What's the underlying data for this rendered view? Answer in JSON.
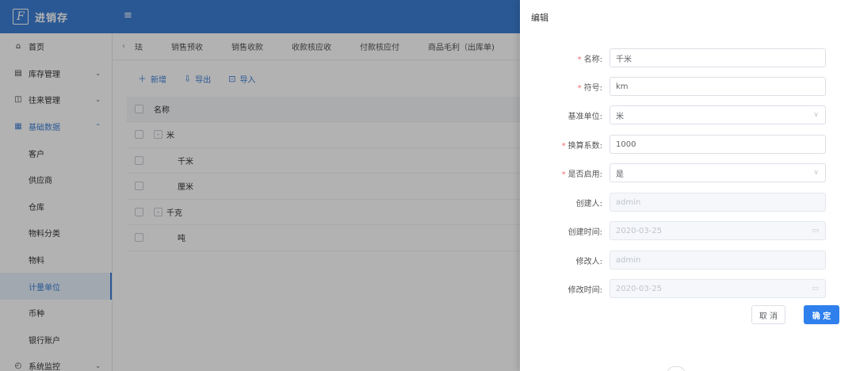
{
  "header": {
    "logo_glyph": "F",
    "app_title": "进销存",
    "collapse_icon": "≡"
  },
  "sidebar": {
    "items": [
      {
        "icon": "⌂",
        "label": "首页",
        "arrow": ""
      },
      {
        "icon": "▤",
        "label": "库存管理",
        "arrow": "⌄"
      },
      {
        "icon": "◫",
        "label": "往来管理",
        "arrow": "⌄"
      },
      {
        "icon": "▦",
        "label": "基础数据",
        "arrow": "⌃"
      }
    ],
    "sub_items": [
      "客户",
      "供应商",
      "仓库",
      "物料分类",
      "物料",
      "计量单位",
      "币种",
      "银行账户"
    ],
    "bottom_item": {
      "icon": "◴",
      "label": "系统监控",
      "arrow": "⌄"
    }
  },
  "tabs": {
    "nav_prev": "‹",
    "items": [
      "珐",
      "销售预收",
      "销售收款",
      "收款核应收",
      "付款核应付",
      "商品毛利（出库单)"
    ]
  },
  "toolbar": {
    "add": "新增",
    "export": "导出",
    "import": "导入"
  },
  "table": {
    "header": "名称",
    "rows": [
      {
        "name": "米",
        "level": 0,
        "expand": "-"
      },
      {
        "name": "千米",
        "level": 1,
        "expand": ""
      },
      {
        "name": "厘米",
        "level": 1,
        "expand": ""
      },
      {
        "name": "千克",
        "level": 0,
        "expand": "-"
      },
      {
        "name": "吨",
        "level": 1,
        "expand": ""
      }
    ]
  },
  "drawer": {
    "title": "编辑",
    "fields": {
      "name": {
        "label": "名称:",
        "value": "千米"
      },
      "symbol": {
        "label": "符号:",
        "value": "km"
      },
      "base_unit": {
        "label": "基准单位:",
        "value": "米"
      },
      "factor": {
        "label": "换算系数:",
        "value": "1000"
      },
      "enabled": {
        "label": "是否启用:",
        "value": "是"
      },
      "creator": {
        "label": "创建人:",
        "value": "admin"
      },
      "created_at": {
        "label": "创建时间:",
        "value": "2020-03-25"
      },
      "modifier": {
        "label": "修改人:",
        "value": "admin"
      },
      "modified_at": {
        "label": "修改时间:",
        "value": "2020-03-25"
      }
    },
    "required_mark": "*",
    "cancel": "取 消",
    "confirm": "确 定"
  },
  "colors": {
    "primary": "#3d7fd4",
    "button": "#2f80ed",
    "required": "#f56c6c"
  }
}
